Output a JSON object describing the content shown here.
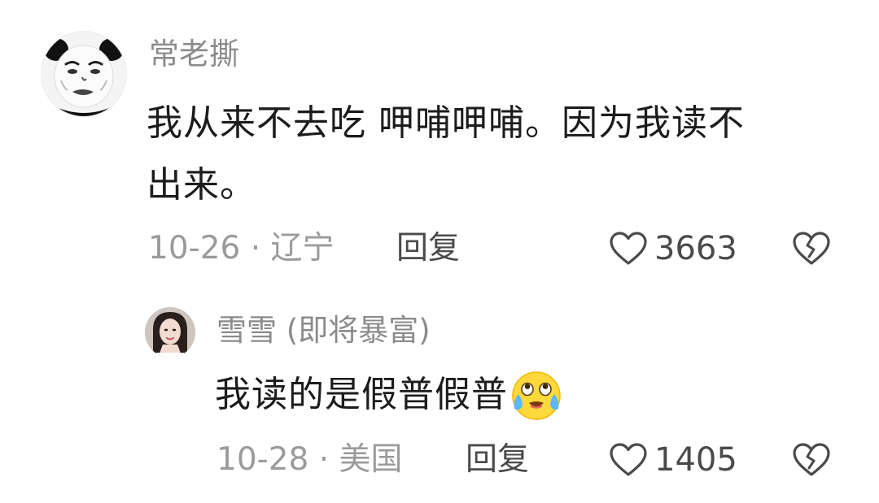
{
  "comments": [
    {
      "author": "常老撕",
      "avatar_icon": "panda-meme-avatar-icon",
      "text": "我从来不去吃 呷哺呷哺。因为我读不\n出来。",
      "date": "10-26",
      "location": "辽宁",
      "separator": " · ",
      "reply_label": "回复",
      "likes": "3663",
      "like_icon": "heart-outline-icon",
      "dislike_icon": "broken-heart-icon"
    },
    {
      "author": "雪雪 (即将暴富)",
      "avatar_icon": "user-photo-avatar-icon",
      "text": "我读的是假普假普",
      "emoji_icon": "crying-laughing-face-emoji-icon",
      "date": "10-28",
      "location": "美国",
      "separator": " · ",
      "reply_label": "回复",
      "likes": "1405",
      "like_icon": "heart-outline-icon",
      "dislike_icon": "broken-heart-icon"
    }
  ],
  "colors": {
    "author": "#8b8b8b",
    "text": "#1c1c1c",
    "meta": "#9b9b9b",
    "action": "#4a4a4a",
    "emoji_yellow": "#ffd93b"
  }
}
